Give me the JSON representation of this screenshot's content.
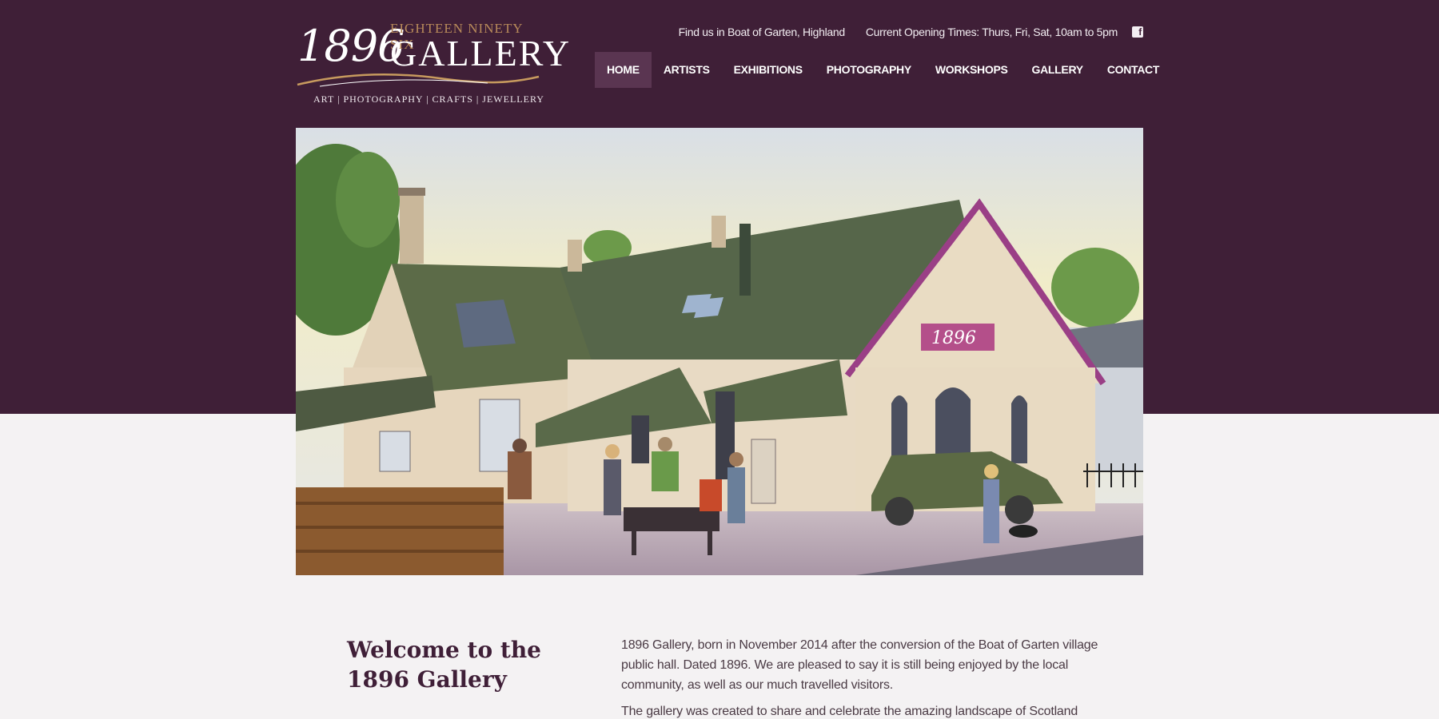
{
  "logo": {
    "year": "1896",
    "subtitle": "EIGHTEEN NINETY SIX",
    "name": "GALLERY",
    "tagline": "ART | PHOTOGRAPHY | CRAFTS | JEWELLERY"
  },
  "topbar": {
    "location": "Find us in Boat of Garten, Highland",
    "hours": "Current Opening Times: Thurs, Fri, Sat, 10am to 5pm",
    "facebook_icon": "f"
  },
  "nav": {
    "items": [
      {
        "label": "HOME",
        "active": true
      },
      {
        "label": "ARTISTS"
      },
      {
        "label": "EXHIBITIONS"
      },
      {
        "label": "PHOTOGRAPHY"
      },
      {
        "label": "WORKSHOPS"
      },
      {
        "label": "GALLERY"
      },
      {
        "label": "CONTACT"
      }
    ]
  },
  "hero": {
    "sign_text": "1896"
  },
  "main": {
    "heading_line1": "Welcome to the",
    "heading_line2": "1896 Gallery",
    "paragraph1": "1896 Gallery, born in November 2014 after the conversion of the Boat of Garten village public hall. Dated 1896. We are pleased to say it is still being enjoyed by the local community, as well as our much travelled visitors.",
    "paragraph2": "The gallery was created to share and celebrate the amazing landscape of Scotland"
  },
  "colors": {
    "header_bg": "#3f1f37",
    "nav_active_bg": "#5a3551",
    "page_bg": "#f4f2f3",
    "logo_accent": "#b88a5a"
  }
}
